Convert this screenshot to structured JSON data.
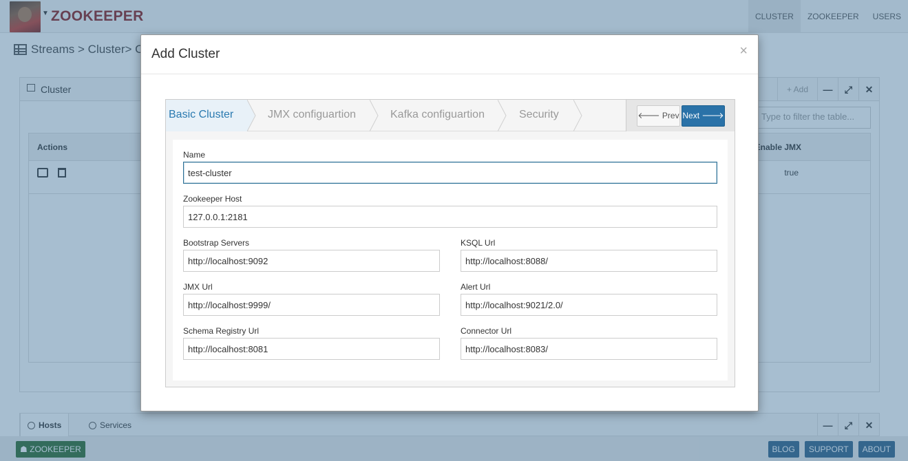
{
  "app": {
    "brand": "ZOOKEEPER",
    "nav": [
      "CLUSTER",
      "ZOOKEEPER",
      "USERS"
    ],
    "breadcrumb": "Streams > Cluster> Clust"
  },
  "panel": {
    "title": "Cluster",
    "add_label": "+ Add",
    "filter_placeholder": "Type to filter the table...",
    "columns": {
      "actions": "Actions",
      "enable_jmx": "Enable JMX"
    },
    "rows": [
      {
        "enable_jmx": "true"
      }
    ]
  },
  "bottom": {
    "tabs": [
      "Hosts",
      "Services"
    ]
  },
  "footer": {
    "left": "ZOOKEEPER",
    "buttons": [
      "BLOG",
      "SUPPORT",
      "ABOUT"
    ]
  },
  "modal": {
    "title": "Add Cluster",
    "close": "×",
    "steps": [
      "Basic Cluster",
      "JMX configuartion",
      "Kafka configuartion",
      "Security"
    ],
    "prev_label": "Prev",
    "next_label": "Next",
    "fields": {
      "name": {
        "label": "Name",
        "value": "test-cluster"
      },
      "zookeeper_host": {
        "label": "Zookeeper Host",
        "value": "127.0.0.1:2181"
      },
      "bootstrap_servers": {
        "label": "Bootstrap Servers",
        "value": "http://localhost:9092"
      },
      "ksql_url": {
        "label": "KSQL Url",
        "value": "http://localhost:8088/"
      },
      "jmx_url": {
        "label": "JMX Url",
        "value": "http://localhost:9999/"
      },
      "alert_url": {
        "label": "Alert Url",
        "value": "http://localhost:9021/2.0/"
      },
      "schema_registry_url": {
        "label": "Schema Registry Url",
        "value": "http://localhost:8081"
      },
      "connector_url": {
        "label": "Connector Url",
        "value": "http://localhost:8083/"
      }
    }
  },
  "colors": {
    "brand": "#8b1a1a",
    "primary": "#2a72a8",
    "active_step": "#2a7ab0",
    "overlay": "#3c6e96"
  }
}
